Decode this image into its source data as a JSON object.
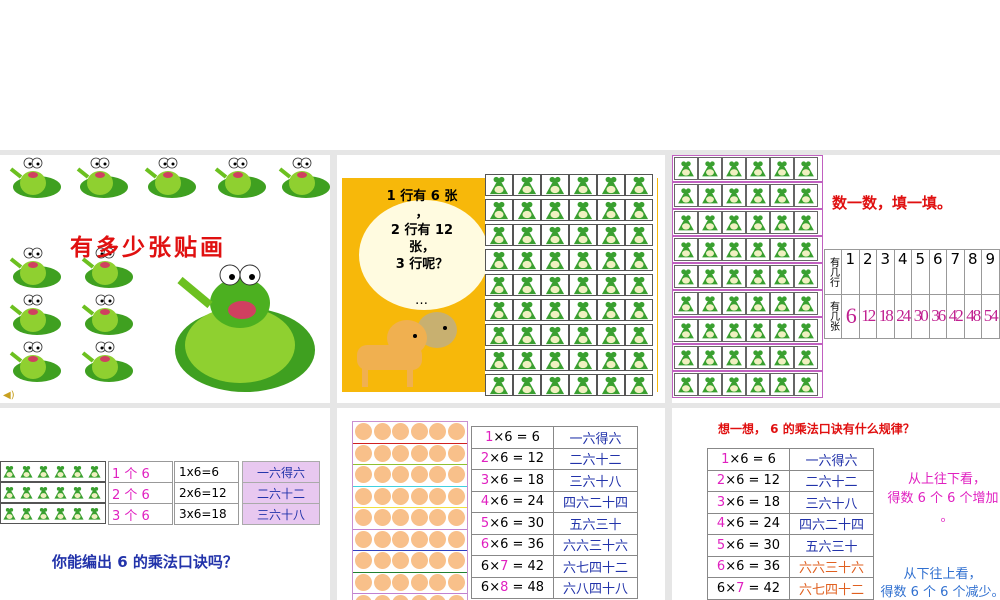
{
  "slide1": {
    "title": "有多少张贴画",
    "speaker_icon": "speaker-icon"
  },
  "slide2": {
    "bubble_lines": [
      "1 行有 6 张",
      "，",
      "2 行有 12",
      "张，",
      "3 行呢？"
    ],
    "ellipsis": "…",
    "grid_rows": 9,
    "grid_cols": 6
  },
  "slide3": {
    "instruction": "数一数，填一填。",
    "row_header": "有几行",
    "count_header": "有几张",
    "rows": [
      "1",
      "2",
      "3",
      "4",
      "5",
      "6",
      "7",
      "8",
      "9"
    ],
    "counts": [
      "6",
      "12",
      "18",
      "24",
      "30",
      "36",
      "42",
      "48",
      "54"
    ]
  },
  "slide4": {
    "groups": [
      "1 个 6",
      "2 个 6",
      "3 个 6"
    ],
    "equations": [
      "1x6=6",
      "2x6=12",
      "3x6=18"
    ],
    "chants": [
      "一六得六",
      "二六十二",
      "三六十八"
    ],
    "question": "你能编出 6 的乘法口诀吗？"
  },
  "slide5": {
    "rows": [
      {
        "a": "1",
        "b": "×6 = 6",
        "chant": "一六得六"
      },
      {
        "a": "2",
        "b": "×6 = 12",
        "chant": "二六十二"
      },
      {
        "a": "3",
        "b": "×6 = 18",
        "chant": "三六十八"
      },
      {
        "a": "4",
        "b": "×6 = 24",
        "chant": "四六二十四"
      },
      {
        "a": "5",
        "b": "×6 = 30",
        "chant": "五六三十"
      },
      {
        "a": "6",
        "b": "×6 = 36",
        "chant": "六六三十六"
      },
      {
        "a": "6×",
        "m": "7",
        "b": " = 42",
        "chant": "六七四十二"
      },
      {
        "a": "6×",
        "m": "8",
        "b": " = 48",
        "chant": "六八四十八"
      }
    ]
  },
  "slide6": {
    "title": "想一想， 6 的乘法口诀有什么规律？",
    "rows": [
      {
        "a": "1",
        "b": "×6 = 6",
        "chant": "一六得六"
      },
      {
        "a": "2",
        "b": "×6 = 12",
        "chant": "二六十二"
      },
      {
        "a": "3",
        "b": "×6 = 18",
        "chant": "三六十八"
      },
      {
        "a": "4",
        "b": "×6 = 24",
        "chant": "四六二十四"
      },
      {
        "a": "5",
        "b": "×6 = 30",
        "chant": "五六三十"
      },
      {
        "a": "6",
        "b": "×6 = 36",
        "chant": "六六三十六"
      },
      {
        "a": "6×",
        "m": "7",
        "b": " = 42",
        "chant": "六七四十二"
      }
    ],
    "note_down_1": "从上往下看，",
    "note_down_2": "得数 6 个 6 个增加",
    "note_down_3": "。",
    "note_up_1": "从下往上看，",
    "note_up_2": "得数 6 个 6 个减少。"
  },
  "colors": {
    "title_red": "#e01010",
    "magenta": "#e020c0",
    "blue": "#2233aa",
    "orange_bg": "#f7b80a",
    "circle": "#f8c08a"
  }
}
